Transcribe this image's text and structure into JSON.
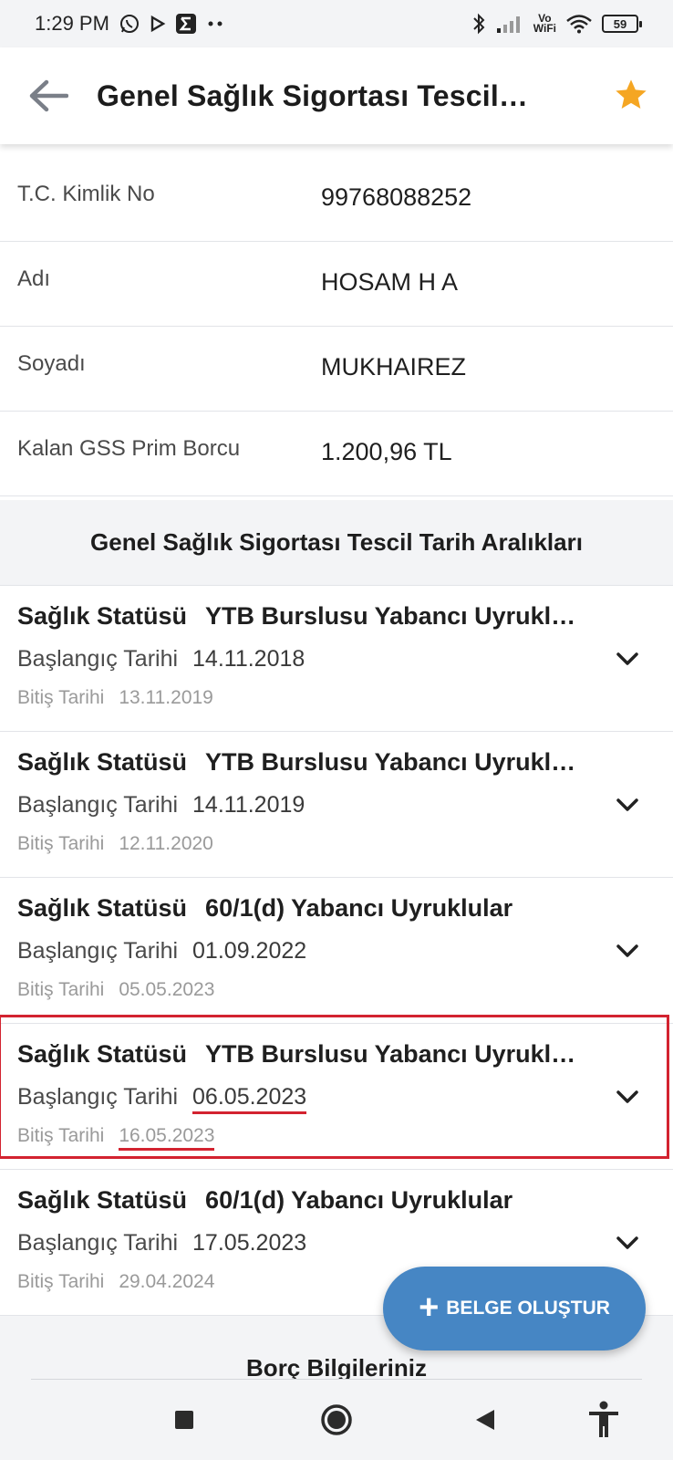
{
  "status_bar": {
    "time": "1:29 PM",
    "vowifi_top": "Vo",
    "vowifi_bottom": "WiFi",
    "battery": "59"
  },
  "app_bar": {
    "title": "Genel Sağlık Sigortası Tescil…",
    "star_color": "#f5a623"
  },
  "info": [
    {
      "label": "T.C. Kimlik No",
      "value": "99768088252"
    },
    {
      "label": "Adı",
      "value": "HOSAM H A"
    },
    {
      "label": "Soyadı",
      "value": "MUKHAIREZ"
    },
    {
      "label": "Kalan GSS Prim Borcu",
      "value": "1.200,96 TL"
    }
  ],
  "section_title": "Genel Sağlık Sigortası Tescil Tarih Aralıkları",
  "records": [
    {
      "status_label": "Sağlık Statüsü",
      "status": "YTB Burslusu Yabancı Uyrukl…",
      "start_label": "Başlangıç Tarihi",
      "start": "14.11.2018",
      "end_label": "Bitiş Tarihi",
      "end": "13.11.2019"
    },
    {
      "status_label": "Sağlık Statüsü",
      "status": "YTB Burslusu Yabancı Uyrukl…",
      "start_label": "Başlangıç Tarihi",
      "start": "14.11.2019",
      "end_label": "Bitiş Tarihi",
      "end": "12.11.2020"
    },
    {
      "status_label": "Sağlık Statüsü",
      "status": "60/1(d) Yabancı Uyruklular",
      "start_label": "Başlangıç Tarihi",
      "start": "01.09.2022",
      "end_label": "Bitiş Tarihi",
      "end": "05.05.2023"
    },
    {
      "status_label": "Sağlık Statüsü",
      "status": "YTB Burslusu Yabancı Uyrukl…",
      "start_label": "Başlangıç Tarihi",
      "start": "06.05.2023",
      "end_label": "Bitiş Tarihi",
      "end": "16.05.2023"
    },
    {
      "status_label": "Sağlık Statüsü",
      "status": "60/1(d) Yabancı Uyruklular",
      "start_label": "Başlangıç Tarihi",
      "start": "17.05.2023",
      "end_label": "Bitiş Tarihi",
      "end": "29.04.2024"
    }
  ],
  "fab_label": "BELGE OLUŞTUR",
  "debt_title": "Borç Bilgileriniz",
  "colors": {
    "accent": "#4686c4",
    "highlight": "#d32330",
    "star": "#f5a623"
  }
}
